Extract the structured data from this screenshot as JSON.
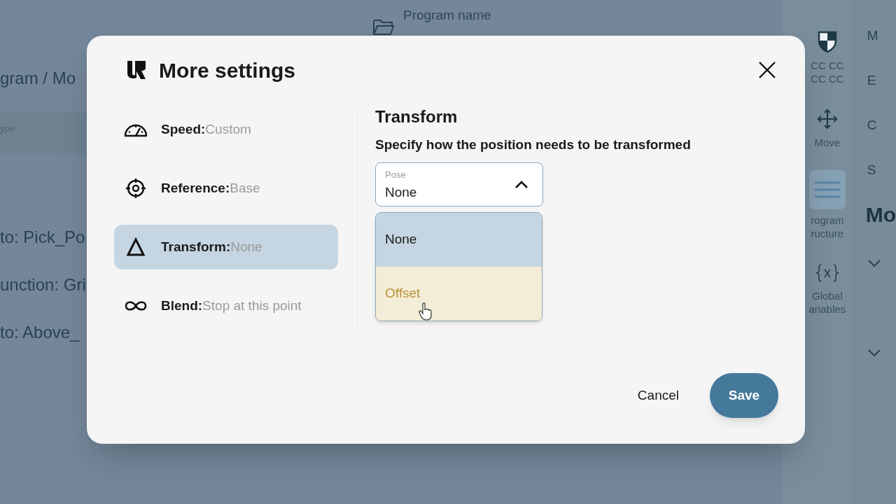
{
  "background": {
    "program_label": "Program name",
    "breadcrumb": "gram / Mo",
    "field_placeholder": "ype",
    "list_items": [
      "to: Pick_Po",
      "unction: Gri",
      "to: Above_"
    ],
    "rail": [
      {
        "kind": "safety",
        "lines": [
          "CC CC",
          "CC CC"
        ],
        "selected": false
      },
      {
        "kind": "move",
        "lines": [
          "Move"
        ],
        "selected": false
      },
      {
        "kind": "structure",
        "lines": [
          "rogram",
          "ructure"
        ],
        "selected": true
      },
      {
        "kind": "variables",
        "lines": [
          "Global",
          "ariables"
        ],
        "selected": false
      }
    ],
    "panel": {
      "letters": [
        "M",
        "E",
        "C",
        "S"
      ],
      "heading": "Mo"
    }
  },
  "dialog": {
    "title": "More settings",
    "settings": [
      {
        "kind": "speed",
        "label": "Speed:",
        "value": "Custom",
        "selected": false
      },
      {
        "kind": "reference",
        "label": "Reference:",
        "value": "Base",
        "selected": false
      },
      {
        "kind": "transform",
        "label": "Transform:",
        "value": "None",
        "selected": true
      },
      {
        "kind": "blend",
        "label": "Blend:",
        "value": "Stop at this point",
        "selected": false
      }
    ],
    "section_title": "Transform",
    "description": "Specify how the position needs to be transformed",
    "select": {
      "label": "Pose",
      "value": "None",
      "expanded": true,
      "options": [
        {
          "label": "None",
          "selected": true,
          "hovered": false
        },
        {
          "label": "Offset",
          "selected": false,
          "hovered": true
        }
      ]
    },
    "buttons": {
      "cancel": "Cancel",
      "save": "Save"
    }
  }
}
